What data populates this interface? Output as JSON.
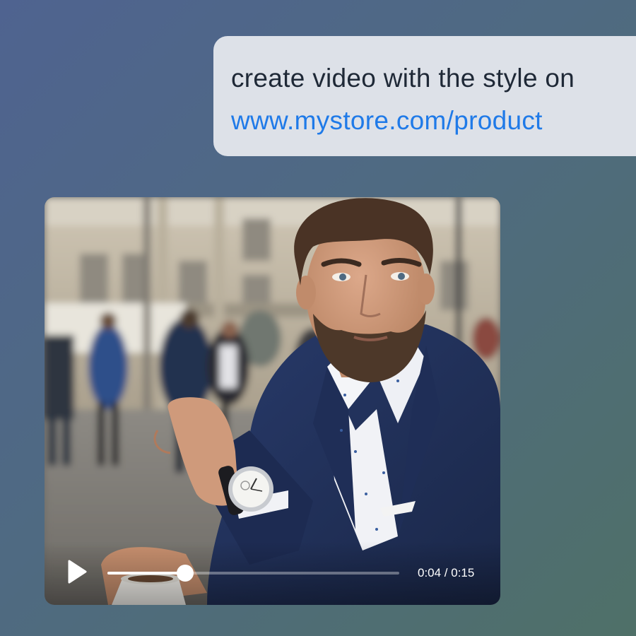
{
  "chat": {
    "message": "create video with the style on",
    "link": "www.mystore.com/product"
  },
  "video": {
    "time_label": "0:04 / 0:15",
    "progress": 0.267,
    "play_icon": "play-icon"
  },
  "colors": {
    "bubble_bg": "#dde1e8",
    "link": "#1f7ae8",
    "text": "#1f2937"
  }
}
